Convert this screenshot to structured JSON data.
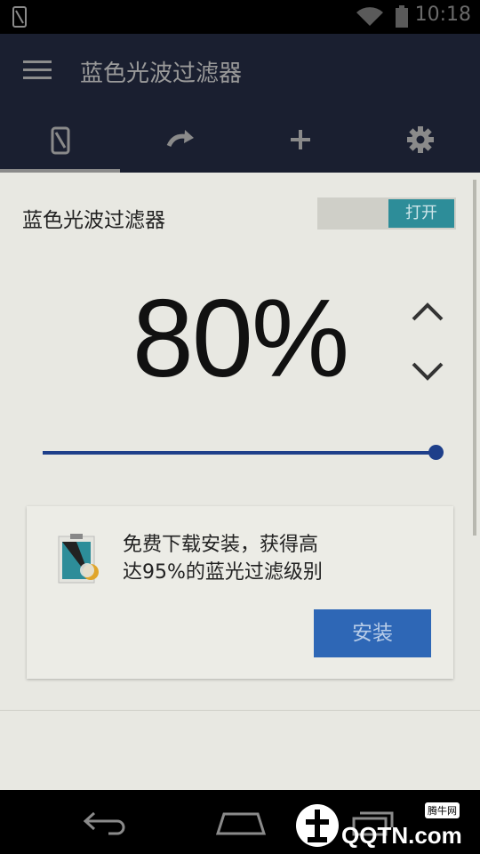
{
  "status_bar": {
    "time": "10:18"
  },
  "app_bar": {
    "title": "蓝色光波过滤器"
  },
  "tabs": [
    {
      "icon": "phone-icon"
    },
    {
      "icon": "redo-icon"
    },
    {
      "icon": "plus-icon"
    },
    {
      "icon": "gear-icon"
    }
  ],
  "filter": {
    "label": "蓝色光波过滤器",
    "toggle_label": "打开",
    "percent_text": "80%",
    "intensity_percent": 100
  },
  "promo": {
    "line1": "免费下载安装，获得高",
    "line2": "达95%的蓝光过滤级别",
    "install_label": "安装"
  },
  "watermark": {
    "brand": "QQTN.com",
    "badge": "腾牛网"
  },
  "colors": {
    "appbar": "#1a1f30",
    "accent": "#2d8d99",
    "slider": "#1e3f8a",
    "install": "#2e67b6"
  }
}
